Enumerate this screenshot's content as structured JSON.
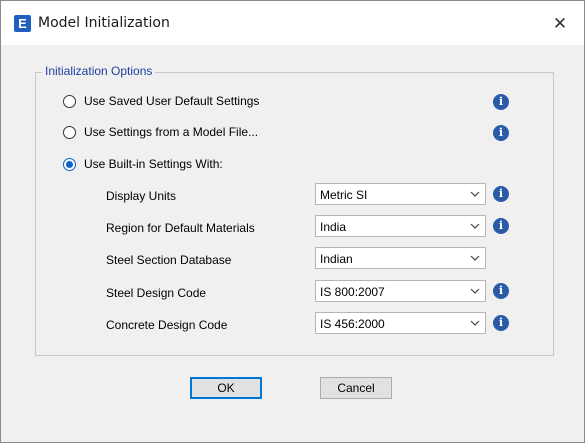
{
  "window": {
    "title": "Model Initialization",
    "app_icon_letter": "E",
    "close_glyph": "✕"
  },
  "group": {
    "label": "Initialization Options"
  },
  "radios": [
    {
      "label": "Use Saved User Default Settings",
      "checked": false
    },
    {
      "label": "Use Settings from a Model File...",
      "checked": false
    },
    {
      "label": "Use Built-in Settings With:",
      "checked": true
    }
  ],
  "fields": [
    {
      "label": "Display Units",
      "value": "Metric SI",
      "info": true
    },
    {
      "label": "Region for Default Materials",
      "value": "India",
      "info": true
    },
    {
      "label": "Steel Section Database",
      "value": "Indian",
      "info": false
    },
    {
      "label": "Steel Design Code",
      "value": "IS 800:2007",
      "info": true
    },
    {
      "label": "Concrete Design Code",
      "value": "IS 456:2000",
      "info": true
    }
  ],
  "buttons": {
    "ok": "OK",
    "cancel": "Cancel"
  },
  "info_glyph": "i",
  "colors": {
    "accent": "#0a62c9",
    "group_label": "#1f3f9f",
    "info_icon": "#2a5aa8"
  }
}
